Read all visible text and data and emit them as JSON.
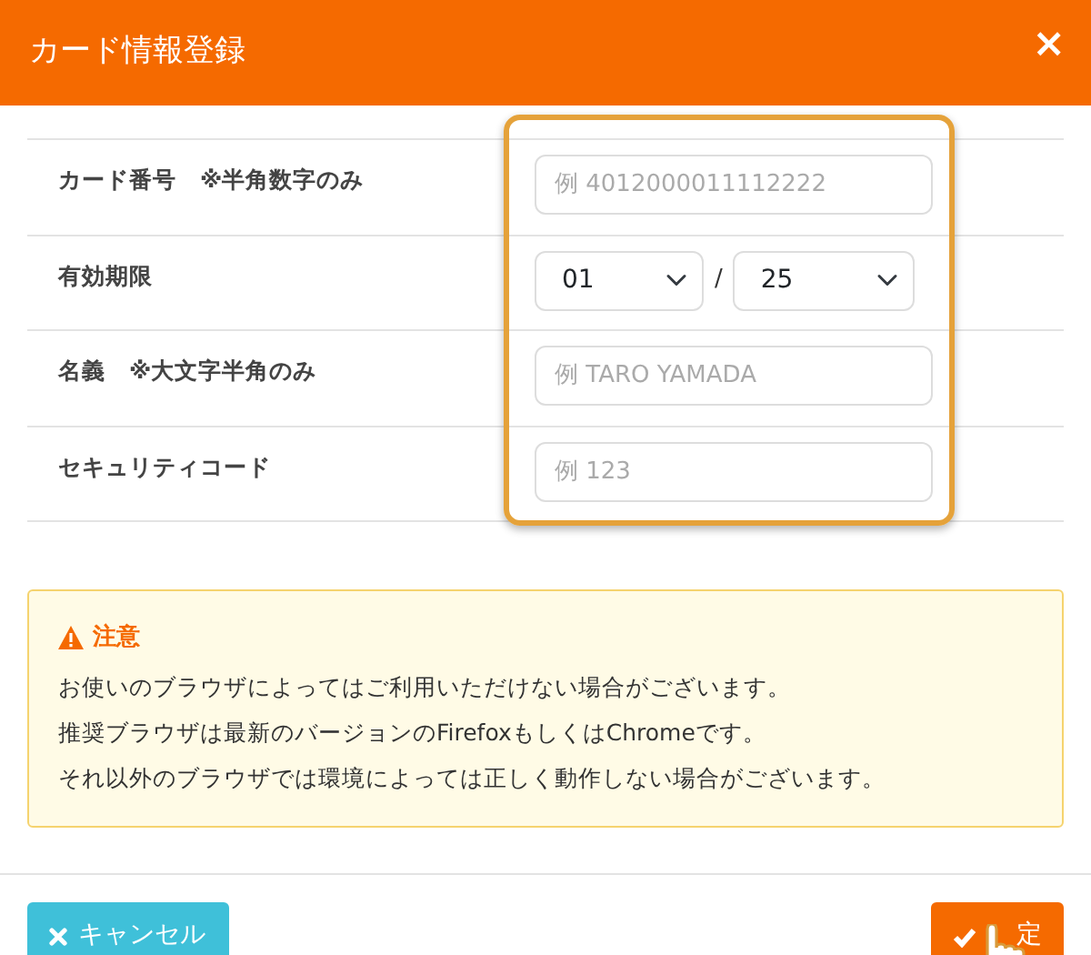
{
  "header": {
    "title": "カード情報登録",
    "close": "×"
  },
  "fields": [
    {
      "kind": "text",
      "label": "カード番号　※半角数字のみ",
      "placeholder": "例 4012000011112222"
    },
    {
      "kind": "expiry",
      "label": "有効期限",
      "month": "01",
      "separator": "/",
      "year": "25"
    },
    {
      "kind": "text",
      "label": "名義　※大文字半角のみ",
      "placeholder": "例 TARO YAMADA"
    },
    {
      "kind": "text",
      "label": "セキュリティコード",
      "placeholder": "例 123"
    }
  ],
  "notice": {
    "title": "注意",
    "lines": [
      "お使いのブラウザによってはご利用いただけない場合がございます。",
      "推奨ブラウザは最新のバージョンのFirefoxもしくはChromeです。",
      "それ以外のブラウザでは環境によっては正しく動作しない場合がございます。"
    ]
  },
  "buttons": [
    {
      "kind": "cancel",
      "label": "キャンセル"
    },
    {
      "kind": "confirm",
      "label": "定"
    }
  ]
}
